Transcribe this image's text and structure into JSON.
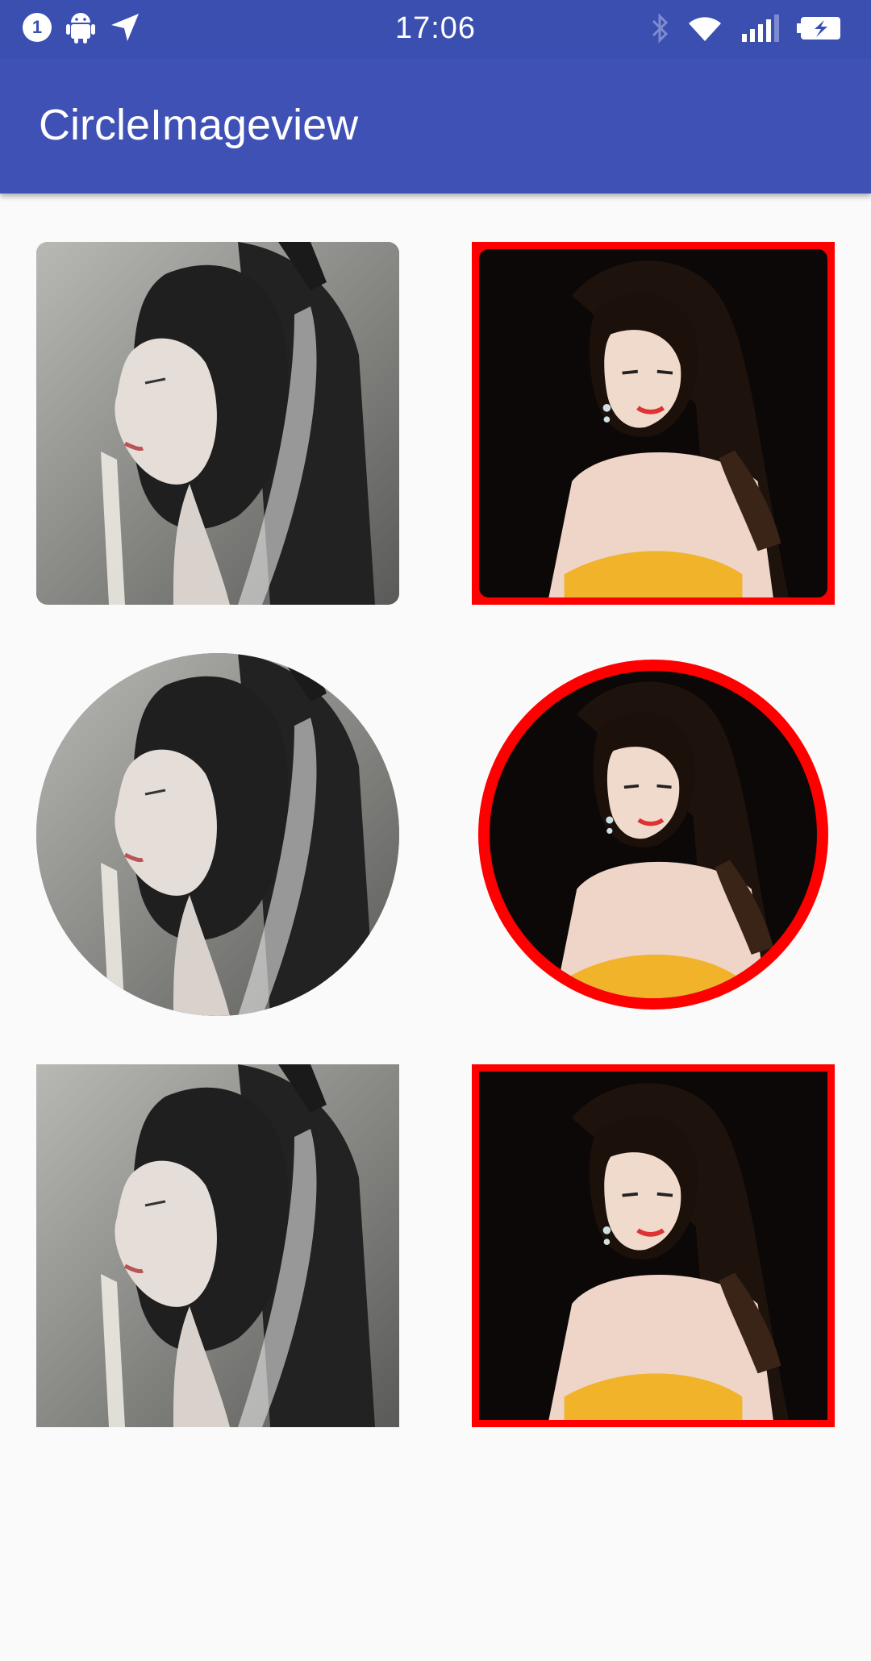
{
  "status_bar": {
    "notification_count": "1",
    "time": "17:06",
    "left_icons": [
      "notification-badge",
      "android-icon",
      "location-arrow-icon"
    ],
    "right_icons": [
      "bluetooth-icon",
      "wifi-icon",
      "signal-icon",
      "battery-charging-icon"
    ]
  },
  "app_bar": {
    "title": "CircleImageview",
    "background_color": "#3f51b5"
  },
  "grid": {
    "rows": [
      {
        "left": {
          "shape": "rounded-square",
          "border": "none"
        },
        "right": {
          "shape": "rounded-square",
          "border": "#ff0000"
        }
      },
      {
        "left": {
          "shape": "circle",
          "border": "none"
        },
        "right": {
          "shape": "circle",
          "border": "#ff0000"
        }
      },
      {
        "left": {
          "shape": "square",
          "border": "none"
        },
        "right": {
          "shape": "square",
          "border": "#ff0000"
        }
      }
    ]
  },
  "colors": {
    "status_bar": "#3a4fb0",
    "accent_border": "#ff0000",
    "background": "#fafafa"
  }
}
